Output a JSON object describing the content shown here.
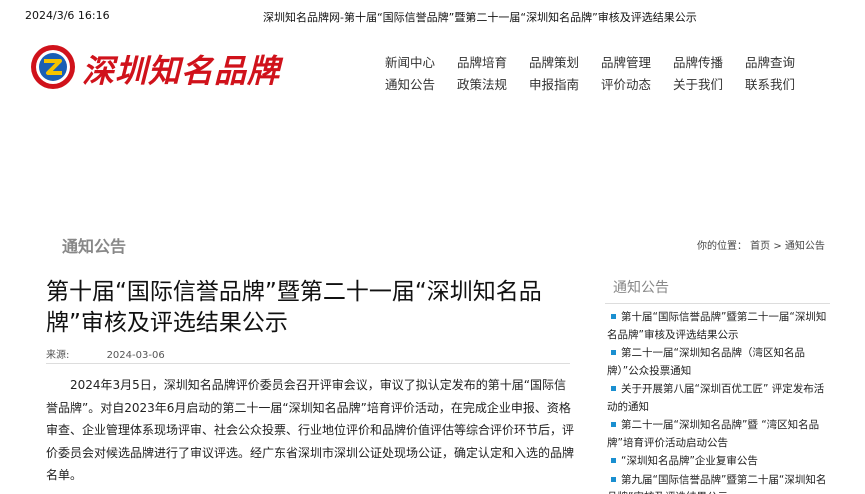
{
  "print_header": {
    "date": "2024/3/6 16:16",
    "title": "深圳知名品牌网-第十届“国际信誉品牌”暨第二十一届“深圳知名品牌”审核及评选结果公示"
  },
  "logo": {
    "text": "深圳知名品牌"
  },
  "colors": {
    "brand": "#d0121b",
    "accent": "#1a8fd0"
  },
  "nav": {
    "row1": [
      "新闻中心",
      "品牌培育",
      "品牌策划",
      "品牌管理",
      "品牌传播",
      "品牌查询"
    ],
    "row2": [
      "通知公告",
      "政策法规",
      "申报指南",
      "评价动态",
      "关于我们",
      "联系我们"
    ]
  },
  "section": {
    "title": "通知公告"
  },
  "breadcrumb": {
    "text": "你的位置： 首页 > 通知公告"
  },
  "article": {
    "title": "第十届“国际信誉品牌”暨第二十一届“深圳知名品牌”审核及评选结果公示",
    "source_label": "来源:",
    "date": "2024-03-06",
    "body": "2024年3月5日，深圳知名品牌评价委员会召开评审会议，审议了拟认定发布的第十届“国际信誉品牌”。对自2023年6月启动的第二十一届“深圳知名品牌”培育评价活动，在完成企业申报、资格审查、企业管理体系现场评审、社会公众投票、行业地位评价和品牌价值评估等综合评价环节后，评价委员会对候选品牌进行了审议评选。经广东省深圳市深圳公证处现场公证，确定认定和入选的品牌名单。"
  },
  "sidebar": {
    "title": "通知公告",
    "items": [
      "第十届“国际信誉品牌”暨第二十一届“深圳知名品牌”审核及评选结果公示",
      "第二十一届“深圳知名品牌（湾区知名品牌）”公众投票通知",
      "关于开展第八届“深圳百优工匠” 评定发布活动的通知",
      "第二十一届“深圳知名品牌”暨 “湾区知名品牌”培育评价活动启动公告",
      "“深圳知名品牌”企业复审公告",
      "第九届“国际信誉品牌”暨第二十届“深圳知名品牌”审核及评选结果公示"
    ]
  }
}
